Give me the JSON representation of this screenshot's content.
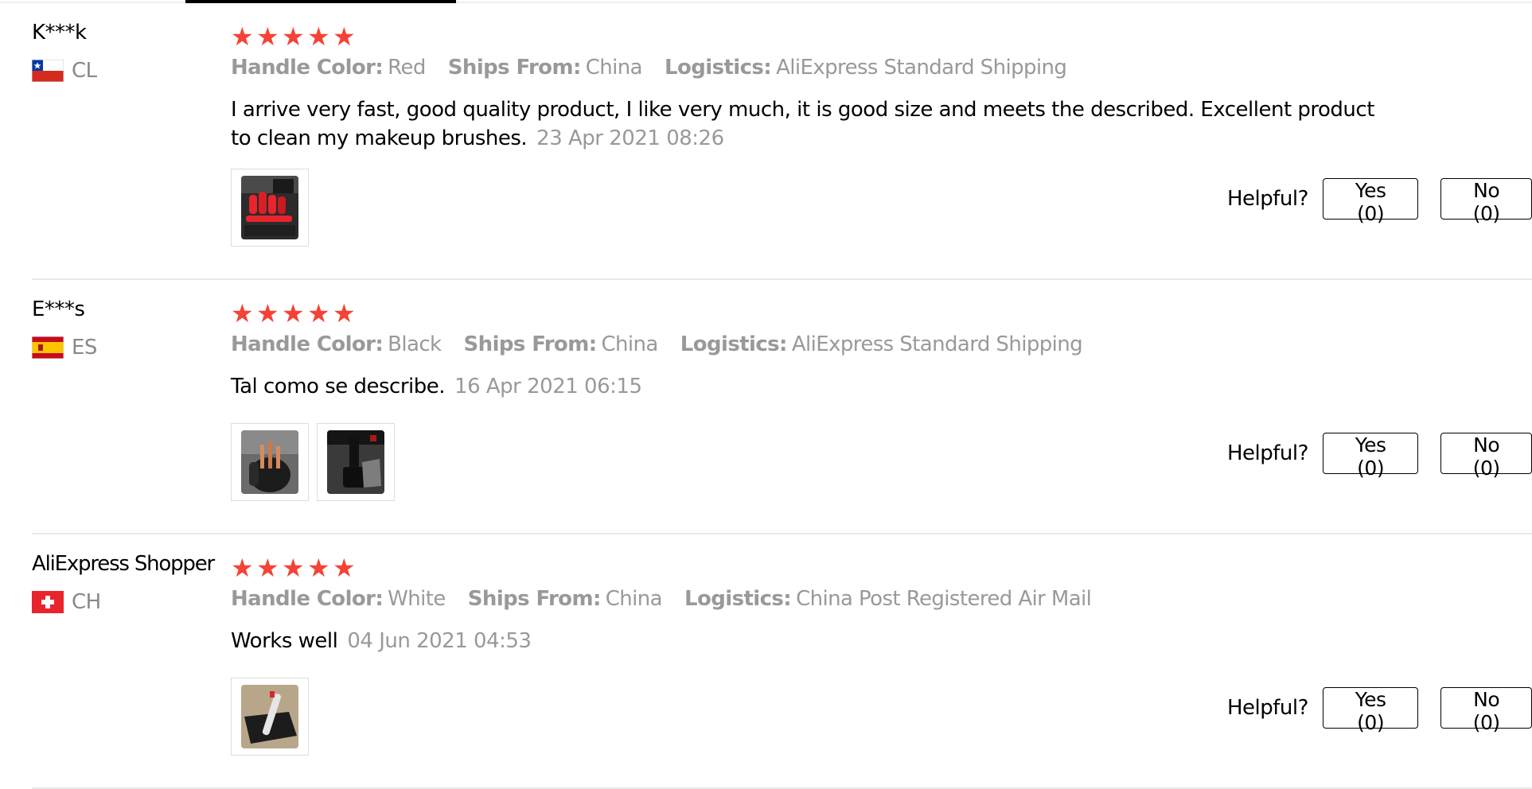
{
  "labels": {
    "handle_color": "Handle Color:",
    "ships_from": "Ships From:",
    "logistics": "Logistics:",
    "helpful": "Helpful?"
  },
  "colors": {
    "star": "#f44336",
    "muted": "#999999"
  },
  "reviews": [
    {
      "user": "K***k",
      "country": "CL",
      "flag_icon": "chile-flag-icon",
      "rating": 5,
      "handle_color": "Red",
      "ships_from": "China",
      "logistics": "AliExpress Standard Shipping",
      "text": "I arrive very fast, good quality product, I like very much, it is good size and meets the described. Excellent product to clean my makeup brushes.",
      "date": "23 Apr 2021 08:26",
      "yes_label": "Yes (0)",
      "no_label": "No (0)"
    },
    {
      "user": "E***s",
      "country": "ES",
      "flag_icon": "spain-flag-icon",
      "rating": 5,
      "handle_color": "Black",
      "ships_from": "China",
      "logistics": "AliExpress Standard Shipping",
      "text": "Tal como se describe.",
      "date": "16 Apr 2021 06:15",
      "yes_label": "Yes (0)",
      "no_label": "No (0)"
    },
    {
      "user": "AliExpress Shopper",
      "country": "CH",
      "flag_icon": "switzerland-flag-icon",
      "rating": 5,
      "handle_color": "White",
      "ships_from": "China",
      "logistics": "China Post Registered Air Mail",
      "text": "Works well",
      "date": "04 Jun 2021 04:53",
      "yes_label": "Yes (0)",
      "no_label": "No (0)"
    }
  ]
}
